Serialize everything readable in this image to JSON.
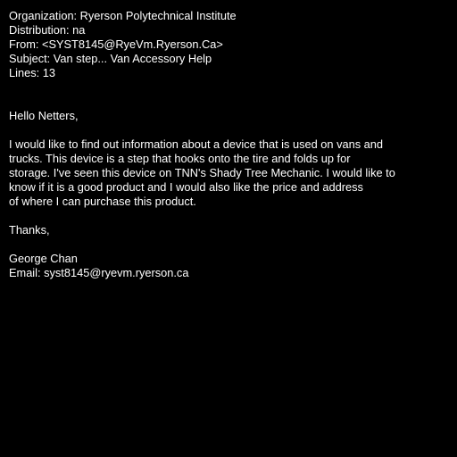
{
  "header": {
    "organization": "Organization: Ryerson Polytechnical Institute",
    "distribution": "Distribution: na",
    "from": "From: <SYST8145@RyeVm.Ryerson.Ca>",
    "subject": "Subject: Van step... Van Accessory Help",
    "lines": "Lines: 13"
  },
  "body": {
    "greeting": "Hello Netters,",
    "paragraph_lines": [
      "I would like to find out information about a device that is used on vans and",
      "trucks. This device is a step that hooks onto the tire and folds up for",
      "storage. I've seen this device on TNN's Shady Tree Mechanic. I would like to",
      "know if it is a good product and I would also like the price and address",
      "of where I can purchase this product."
    ],
    "closing": "Thanks,",
    "signature_name": "George Chan",
    "signature_email": "Email: syst8145@ryevm.ryerson.ca"
  }
}
